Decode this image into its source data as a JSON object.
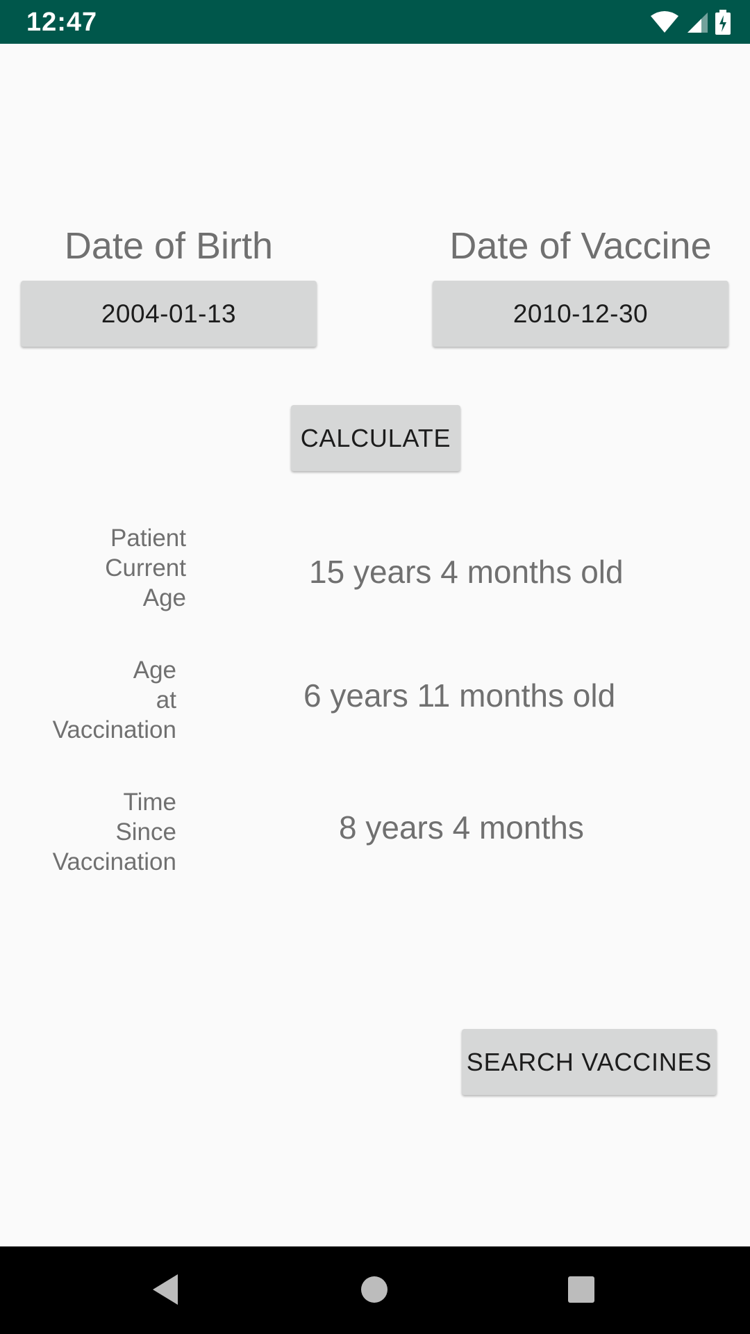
{
  "status_bar": {
    "time": "12:47",
    "background_color": "#00574b",
    "icons": [
      "wifi-icon",
      "cellular-signal-icon",
      "battery-charging-icon"
    ]
  },
  "birth": {
    "heading": "Date of Birth",
    "value": "2004-01-13"
  },
  "vaccine": {
    "heading": "Date of Vaccine",
    "value": "2010-12-30"
  },
  "calculate_label": "Calculate",
  "rows": [
    {
      "label": "Patient\nCurrent\nAge",
      "value": "15 years 4 months old"
    },
    {
      "label": "Age\nat\nVaccination",
      "value": "6 years 11 months old"
    },
    {
      "label": "Time\nSince\nVaccination",
      "value": "8 years 4 months"
    }
  ],
  "search_label": "Search Vaccines",
  "nav_bar": {
    "icons": [
      "back-icon",
      "home-icon",
      "recents-icon"
    ]
  },
  "colors": {
    "background": "#fafafa",
    "button": "#d6d7d7",
    "secondary_text": "#707070"
  }
}
